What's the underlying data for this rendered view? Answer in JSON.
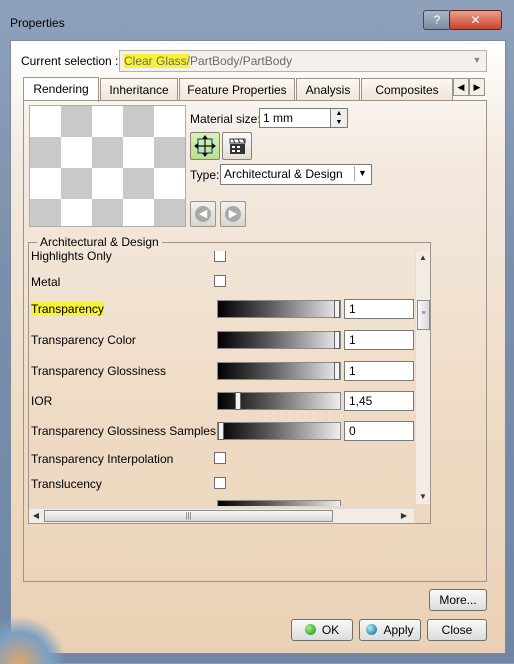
{
  "window": {
    "title": "Properties",
    "help_label": "?",
    "close_label": "✕"
  },
  "selection": {
    "label": "Current selection :",
    "highlight": "Clear Glass/",
    "rest": "PartBody/PartBody"
  },
  "tabs": [
    {
      "label": "Rendering",
      "active": true
    },
    {
      "label": "Inheritance"
    },
    {
      "label": "Feature Properties"
    },
    {
      "label": "Analysis"
    },
    {
      "label": "Composites"
    }
  ],
  "rendering": {
    "material_size_label": "Material size:",
    "material_size_value": "1 mm",
    "type_label": "Type:",
    "type_value": "Architectural & Design"
  },
  "group": {
    "title": "Architectural & Design",
    "rows": [
      {
        "label": "Highlights Only",
        "kind": "checkbox"
      },
      {
        "label": "Metal",
        "kind": "checkbox"
      },
      {
        "label": "Transparency",
        "kind": "slider",
        "value": "1",
        "level": 1.0,
        "highlighted": true
      },
      {
        "label": "Transparency Color",
        "kind": "slider",
        "value": "1",
        "level": 1.0
      },
      {
        "label": "Transparency Glossiness",
        "kind": "slider",
        "value": "1",
        "level": 1.0
      },
      {
        "label": "IOR",
        "kind": "slider",
        "value": "1,45",
        "level": 0.15
      },
      {
        "label": "Transparency Glossiness Samples",
        "kind": "slider",
        "value": "0",
        "level": 0.0
      },
      {
        "label": "Transparency Interpolation",
        "kind": "checkbox"
      },
      {
        "label": "Translucency",
        "kind": "checkbox"
      }
    ]
  },
  "buttons": {
    "more": "More...",
    "ok": "OK",
    "apply": "Apply",
    "close": "Close"
  }
}
